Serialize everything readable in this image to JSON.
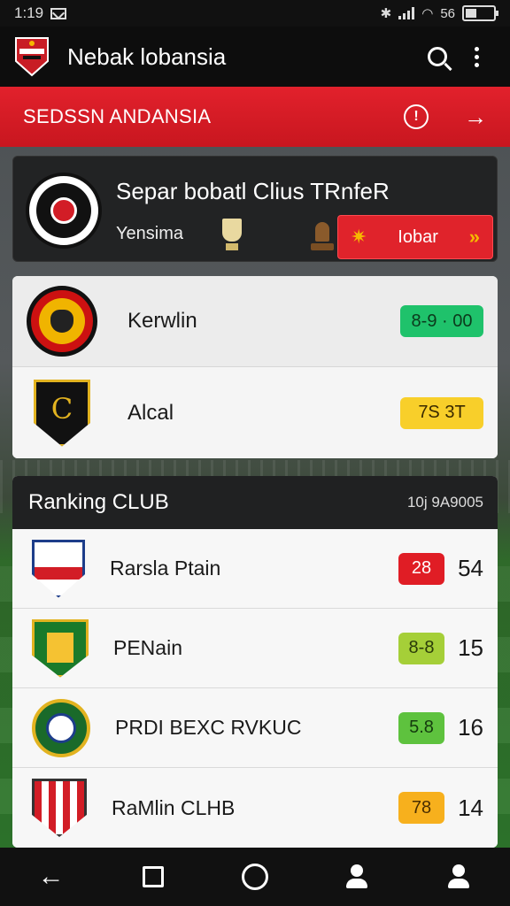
{
  "status_bar": {
    "time": "1:19",
    "signal_text": "56"
  },
  "app_bar": {
    "title": "Nebak lobansia",
    "logo_icon": "club-crest-icon",
    "search_icon": "search-icon",
    "menu_icon": "more-vert-icon"
  },
  "banner": {
    "title": "SEDSSN ANDANSIA",
    "info_icon": "info-icon",
    "arrow_icon": "arrow-right-icon"
  },
  "transfer_card": {
    "title": "Separ bobatl Clius TRnfeR",
    "subtitle": "Yensima",
    "button_label": "Iobar",
    "button_star": "✷",
    "button_chevron": "»"
  },
  "transfers": [
    {
      "name": "Kerwlin",
      "value": "8-9 · 00",
      "color": "green"
    },
    {
      "name": "Alcal",
      "value": "7S  3T",
      "color": "yellow"
    }
  ],
  "ranking": {
    "title": "Ranking CLUB",
    "date": "10j 9A9005",
    "rows": [
      {
        "name": "Rarsla Ptain",
        "score": "28",
        "points": "54",
        "color": "red"
      },
      {
        "name": "PENain",
        "score": "8-8",
        "points": "15",
        "color": "lime"
      },
      {
        "name": "PRDI BEXC RVKUC",
        "score": "5.8",
        "points": "16",
        "color": "green"
      },
      {
        "name": "RaMlin CLHB",
        "score": "78",
        "points": "14",
        "color": "orange"
      }
    ]
  },
  "nav": {
    "back": "←",
    "back_icon": "back-icon",
    "recents_icon": "recents-square-icon",
    "home_icon": "home-circle-icon",
    "assistant_icon": "assistant-icon",
    "profile_icon": "profile-icon"
  },
  "colors": {
    "accent_red": "#e2212c",
    "app_bar": "#0d0d0d",
    "pill_green": "#1fc26b",
    "pill_yellow": "#f8cf2a"
  }
}
